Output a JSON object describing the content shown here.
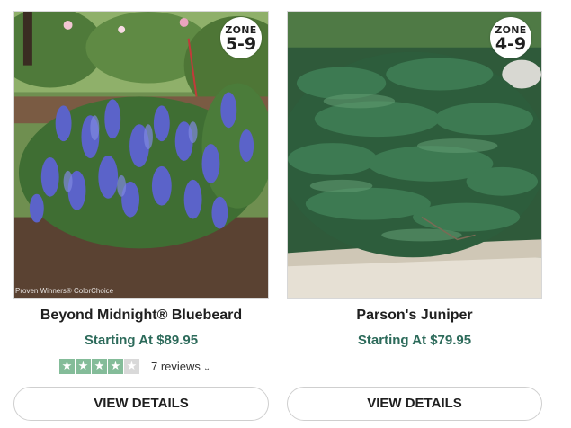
{
  "products": [
    {
      "name": "Beyond Midnight® Bluebeard",
      "price": "Starting At $89.95",
      "zone_label": "ZONE",
      "zone_range": "5-9",
      "photo_credit": "Proven Winners® ColorChoice",
      "rating_stars": 4,
      "rating_max": 5,
      "reviews_label": "7 reviews",
      "button_label": "VIEW DETAILS"
    },
    {
      "name": "Parson's Juniper",
      "price": "Starting At $79.95",
      "zone_label": "ZONE",
      "zone_range": "4-9",
      "button_label": "VIEW DETAILS"
    }
  ],
  "colors": {
    "price": "#2c6a5a",
    "star_filled": "#84bc99",
    "star_empty": "#d9d9d9",
    "button_border": "#cfcfcf"
  },
  "icons": {
    "star": "★",
    "chevron": "⌄"
  }
}
